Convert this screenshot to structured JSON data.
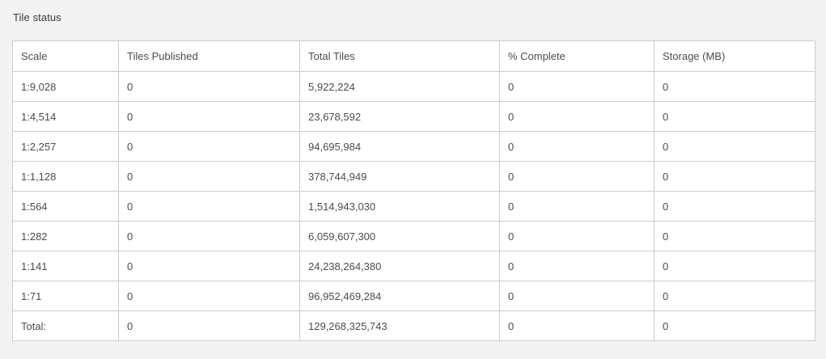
{
  "panel": {
    "title": "Tile status"
  },
  "table": {
    "headers": {
      "scale": "Scale",
      "tiles_published": "Tiles Published",
      "total_tiles": "Total Tiles",
      "percent_complete": "% Complete",
      "storage": "Storage (MB)"
    },
    "rows": [
      {
        "scale": "1:9,028",
        "tiles_published": "0",
        "total_tiles": "5,922,224",
        "percent_complete": "0",
        "storage": "0"
      },
      {
        "scale": "1:4,514",
        "tiles_published": "0",
        "total_tiles": "23,678,592",
        "percent_complete": "0",
        "storage": "0"
      },
      {
        "scale": "1:2,257",
        "tiles_published": "0",
        "total_tiles": "94,695,984",
        "percent_complete": "0",
        "storage": "0"
      },
      {
        "scale": "1:1,128",
        "tiles_published": "0",
        "total_tiles": "378,744,949",
        "percent_complete": "0",
        "storage": "0"
      },
      {
        "scale": "1:564",
        "tiles_published": "0",
        "total_tiles": "1,514,943,030",
        "percent_complete": "0",
        "storage": "0"
      },
      {
        "scale": "1:282",
        "tiles_published": "0",
        "total_tiles": "6,059,607,300",
        "percent_complete": "0",
        "storage": "0"
      },
      {
        "scale": "1:141",
        "tiles_published": "0",
        "total_tiles": "24,238,264,380",
        "percent_complete": "0",
        "storage": "0"
      },
      {
        "scale": "1:71",
        "tiles_published": "0",
        "total_tiles": "96,952,469,284",
        "percent_complete": "0",
        "storage": "0"
      }
    ],
    "total": {
      "scale": "Total:",
      "tiles_published": "0",
      "total_tiles": "129,268,325,743",
      "percent_complete": "0",
      "storage": "0"
    }
  }
}
